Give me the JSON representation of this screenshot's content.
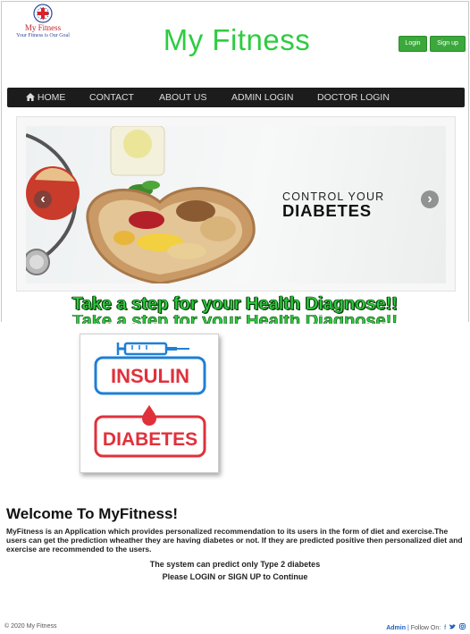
{
  "header": {
    "logo_name": "My Fitness",
    "logo_tagline": "Your Fitness is Our Goal",
    "site_title": "My Fitness",
    "login_label": "Login",
    "signup_label": "Sign up"
  },
  "nav": {
    "items": [
      {
        "label": "HOME",
        "icon": "home-icon"
      },
      {
        "label": "CONTACT"
      },
      {
        "label": "ABOUT US"
      },
      {
        "label": "ADMIN LOGIN"
      },
      {
        "label": "DOCTOR LOGIN"
      }
    ]
  },
  "carousel": {
    "prev_glyph": "‹",
    "next_glyph": "›",
    "caption_line1": "CONTROL YOUR",
    "caption_line2": "DIABETES"
  },
  "headline": "Take a step for your Health Diagnose!!",
  "card": {
    "word1": "INSULIN",
    "word2": "DIABETES"
  },
  "main": {
    "welcome_title": "Welcome To MyFitness!",
    "description": "MyFitness is an Application which provides personalized recommendation to its users in the form of diet and exercise.The users can get the prediction wheather they are having diabetes or not. If they are predicted positive then personalized diet and exercise are recommended to the users.",
    "note": "The system can predict only Type 2 diabetes",
    "cta": "Please LOGIN or SIGN UP to Continue"
  },
  "footer": {
    "copyright": "© 2020 My Fitness",
    "admin_link": "Admin",
    "separator": "|",
    "follow_label": "Follow On:",
    "social_icons": [
      "facebook-icon",
      "twitter-icon",
      "instagram-icon"
    ]
  },
  "colors": {
    "accent_green": "#2ecc40",
    "navbar_bg": "#1c1c1c",
    "badge_blue": "#1f7fd6",
    "badge_red": "#e0313b"
  }
}
